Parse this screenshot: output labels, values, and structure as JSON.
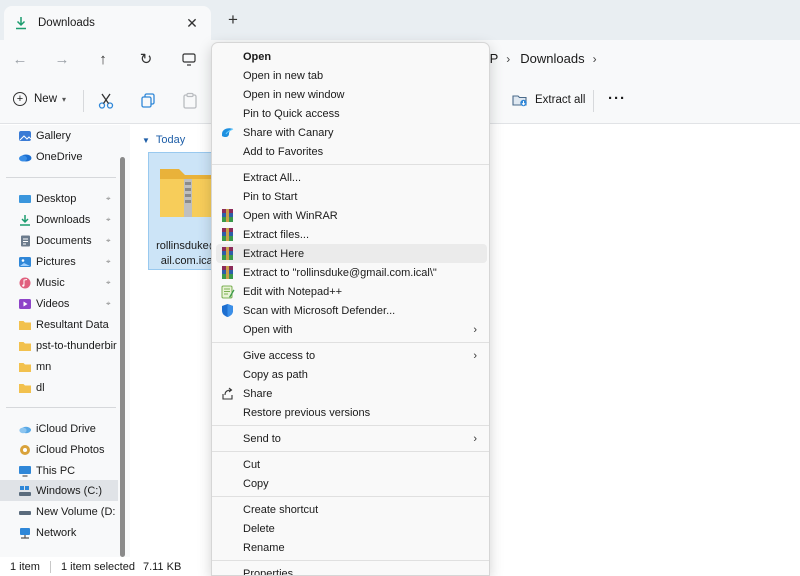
{
  "window": {
    "tab_title": "Downloads",
    "tab_close": "✕",
    "new_tab": "+"
  },
  "address": {
    "back": "←",
    "forward": "→",
    "up": "↑",
    "refresh": "↻",
    "crumbs": [
      "IP",
      "Downloads"
    ],
    "crumb_sep": "›"
  },
  "toolbar": {
    "new_label": "New",
    "extract_all_label": "Extract all",
    "more_label": "···"
  },
  "sidebar": {
    "top_items": [
      {
        "label": "Gallery",
        "icon": "gallery-icon",
        "color": "#3a7bd5"
      },
      {
        "label": "OneDrive",
        "icon": "onedrive-icon",
        "color": "#1c6fd1"
      }
    ],
    "quick_items": [
      {
        "label": "Desktop",
        "icon": "desktop-icon",
        "color": "#3a96dd",
        "pinned": true
      },
      {
        "label": "Downloads",
        "icon": "downloads-icon",
        "color": "#1b9c6e",
        "pinned": true
      },
      {
        "label": "Documents",
        "icon": "documents-icon",
        "color": "#6b7b8c",
        "pinned": true
      },
      {
        "label": "Pictures",
        "icon": "pictures-icon",
        "color": "#2f87d8",
        "pinned": true
      },
      {
        "label": "Music",
        "icon": "music-icon",
        "color": "#e0607e",
        "pinned": true
      },
      {
        "label": "Videos",
        "icon": "videos-icon",
        "color": "#8e44c8",
        "pinned": true
      },
      {
        "label": "Resultant Data",
        "icon": "folder-icon",
        "color": "#f2c14e",
        "pinned": false
      },
      {
        "label": "pst-to-thunderbir",
        "icon": "folder-icon",
        "color": "#f2c14e",
        "pinned": false
      },
      {
        "label": "mn",
        "icon": "folder-icon",
        "color": "#f2c14e",
        "pinned": false
      },
      {
        "label": "dl",
        "icon": "folder-icon",
        "color": "#f2c14e",
        "pinned": false
      }
    ],
    "bottom_items": [
      {
        "label": "iCloud Drive",
        "icon": "icloud-icon",
        "color": "#5aa9e6"
      },
      {
        "label": "iCloud Photos",
        "icon": "icloud-photos-icon",
        "color": "#d9a23a"
      },
      {
        "label": "This PC",
        "icon": "pc-icon",
        "color": "#2f87d8"
      },
      {
        "label": "Windows (C:)",
        "icon": "drive-icon",
        "color": "#5a6b7c",
        "selected": true
      },
      {
        "label": "New Volume (D:",
        "icon": "drive-icon",
        "color": "#5a6b7c"
      },
      {
        "label": "Network",
        "icon": "network-icon",
        "color": "#2f87d8"
      }
    ],
    "pin_glyph": "📌"
  },
  "content": {
    "group_label": "Today",
    "group_chevron": "⌄",
    "file_name_line1": "rollinsduke@",
    "file_name_line2": "ail.com.ical"
  },
  "status": {
    "count": "1 item",
    "selected": "1 item selected",
    "size": "7.11 KB"
  },
  "menu": {
    "items": [
      {
        "label": "Open",
        "bold": true
      },
      {
        "label": "Open in new tab"
      },
      {
        "label": "Open in new window"
      },
      {
        "label": "Pin to Quick access"
      },
      {
        "label": "Share with Canary",
        "icon": "canary-icon"
      },
      {
        "label": "Add to Favorites"
      },
      {
        "sep": true
      },
      {
        "label": "Extract All..."
      },
      {
        "label": "Pin to Start"
      },
      {
        "label": "Open with WinRAR",
        "icon": "winrar-icon"
      },
      {
        "label": "Extract files...",
        "icon": "winrar-icon"
      },
      {
        "label": "Extract Here",
        "icon": "winrar-icon",
        "hover": true
      },
      {
        "label": "Extract to \"rollinsduke@gmail.com.ical\\\"",
        "icon": "winrar-icon"
      },
      {
        "label": "Edit with Notepad++",
        "icon": "notepadpp-icon"
      },
      {
        "label": "Scan with Microsoft Defender...",
        "icon": "defender-icon"
      },
      {
        "label": "Open with",
        "submenu": true
      },
      {
        "sep": true
      },
      {
        "label": "Give access to",
        "submenu": true
      },
      {
        "label": "Copy as path"
      },
      {
        "label": "Share",
        "icon": "share-icon"
      },
      {
        "label": "Restore previous versions"
      },
      {
        "sep": true
      },
      {
        "label": "Send to",
        "submenu": true
      },
      {
        "sep": true
      },
      {
        "label": "Cut"
      },
      {
        "label": "Copy"
      },
      {
        "sep": true
      },
      {
        "label": "Create shortcut"
      },
      {
        "label": "Delete"
      },
      {
        "label": "Rename"
      },
      {
        "sep": true
      },
      {
        "label": "Properties"
      }
    ],
    "submenu_arrow": "›"
  }
}
